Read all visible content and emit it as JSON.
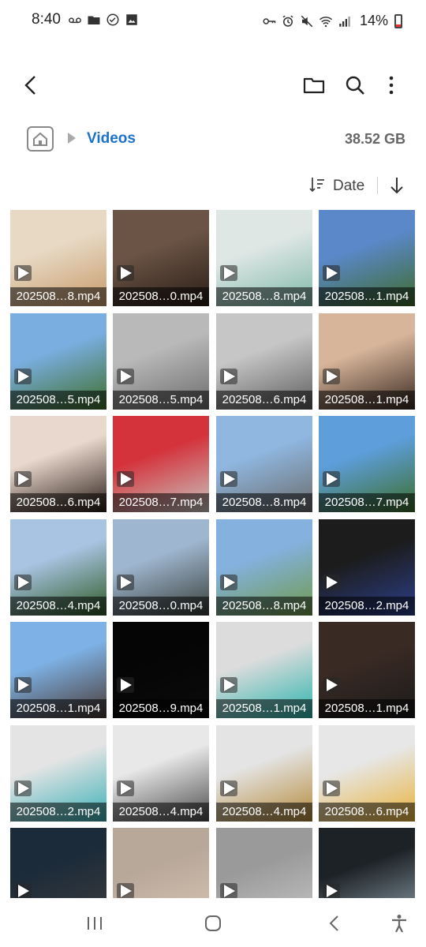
{
  "status_bar": {
    "time": "8:40",
    "left_icons": [
      "voicemail-icon",
      "folder-icon",
      "check-circle-icon",
      "image-icon"
    ],
    "right_icons": [
      "key-icon",
      "alarm-icon",
      "mute-icon",
      "wifi-icon",
      "signal-icon"
    ],
    "battery": "14%"
  },
  "app_bar": {
    "icons": [
      "back-icon",
      "folder-icon",
      "search-icon",
      "more-vert-icon"
    ]
  },
  "breadcrumb": {
    "current": "Videos",
    "storage": "38.52 GB"
  },
  "sort": {
    "label": "Date",
    "direction": "descending"
  },
  "files": [
    {
      "name": "202508…8.mp4"
    },
    {
      "name": "202508…0.mp4"
    },
    {
      "name": "202508…8.mp4"
    },
    {
      "name": "202508…1.mp4"
    },
    {
      "name": "202508…5.mp4"
    },
    {
      "name": "202508…5.mp4"
    },
    {
      "name": "202508…6.mp4"
    },
    {
      "name": "202508…1.mp4"
    },
    {
      "name": "202508…6.mp4"
    },
    {
      "name": "202508…7.mp4"
    },
    {
      "name": "202508…8.mp4"
    },
    {
      "name": "202508…7.mp4"
    },
    {
      "name": "202508…4.mp4"
    },
    {
      "name": "202508…0.mp4"
    },
    {
      "name": "202508…8.mp4"
    },
    {
      "name": "202508…2.mp4"
    },
    {
      "name": "202508…1.mp4"
    },
    {
      "name": "202508…9.mp4"
    },
    {
      "name": "202508…1.mp4"
    },
    {
      "name": "202508…1.mp4"
    },
    {
      "name": "202508…2.mp4"
    },
    {
      "name": "202508…4.mp4"
    },
    {
      "name": "202508…4.mp4"
    },
    {
      "name": "202508…6.mp4"
    },
    {
      "name": ""
    },
    {
      "name": ""
    },
    {
      "name": ""
    },
    {
      "name": ""
    }
  ],
  "thumb_colors": [
    [
      "#e7d9c4",
      "#c89a6a"
    ],
    [
      "#6b5445",
      "#2a1d17"
    ],
    [
      "#dfe7e5",
      "#7fb9a9"
    ],
    [
      "#5a88c8",
      "#3f6b2c"
    ],
    [
      "#7aaee0",
      "#3e6e2a"
    ],
    [
      "#b9b9b9",
      "#6c6c6c"
    ],
    [
      "#c6c6c6",
      "#5e5e5e"
    ],
    [
      "#d7b59a",
      "#3a2a22"
    ],
    [
      "#e9d8cd",
      "#2b1e18"
    ],
    [
      "#d4333c",
      "#c8c4be"
    ],
    [
      "#8fb7e0",
      "#6c6c6c"
    ],
    [
      "#5d9edb",
      "#3d6e2b"
    ],
    [
      "#a9c4e3",
      "#2f5a26"
    ],
    [
      "#9eb6cf",
      "#3a3f3a"
    ],
    [
      "#84b1de",
      "#6f9a4c"
    ],
    [
      "#1c1c1c",
      "#2c3f8a"
    ],
    [
      "#7eb2e6",
      "#4a3a34"
    ],
    [
      "#050505",
      "#0b0b0b"
    ],
    [
      "#dcdcdc",
      "#2bb4ad"
    ],
    [
      "#3a2a24",
      "#1b1b1b"
    ],
    [
      "#e4e4e4",
      "#39b0b7"
    ],
    [
      "#e8e8e8",
      "#4d4d4d"
    ],
    [
      "#e4e4e4",
      "#b58a3a"
    ],
    [
      "#e7e7e7",
      "#e8b23a"
    ],
    [
      "#1c2b3a",
      "#3c3c3c"
    ],
    [
      "#b8a89a",
      "#d7c3b0"
    ],
    [
      "#9a9a9a",
      "#c4c4c4"
    ],
    [
      "#1d2226",
      "#8a9aa6"
    ]
  ],
  "nav_bar": {
    "icons": [
      "recents-icon",
      "home-icon",
      "back-icon",
      "accessibility-icon"
    ]
  }
}
